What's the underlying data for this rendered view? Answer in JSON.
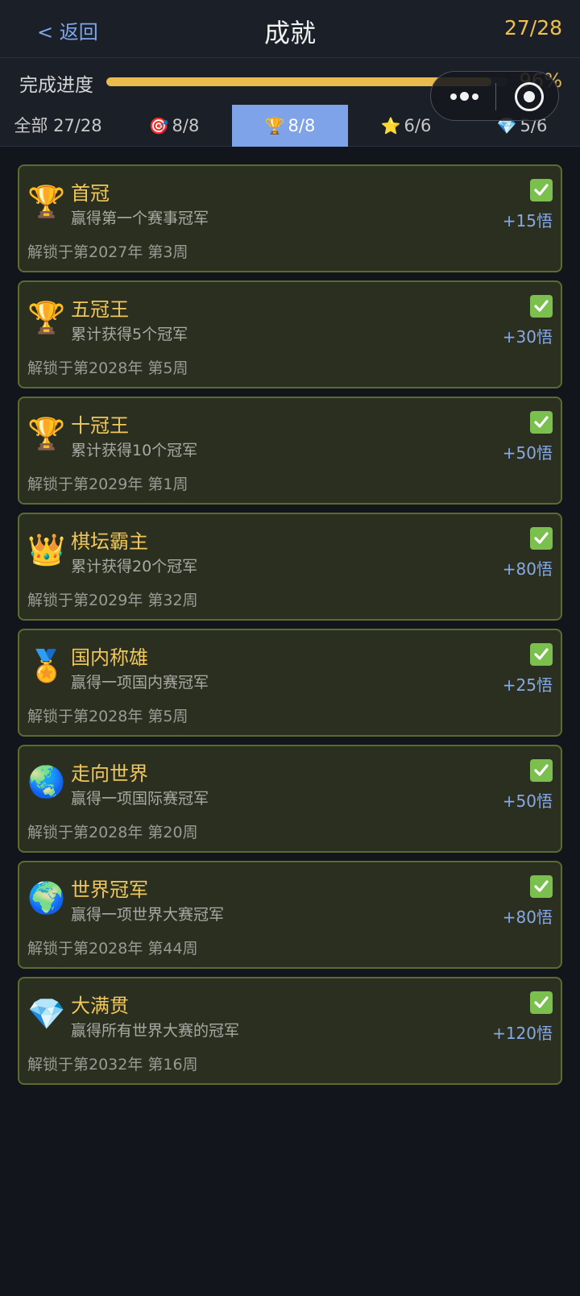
{
  "header": {
    "back_label": "< 返回",
    "title": "成就",
    "count": "27/28"
  },
  "progress": {
    "label": "完成进度",
    "percent_text": "96%",
    "fraction": 0.96
  },
  "tabs": [
    {
      "icon": "",
      "icon_name": "",
      "label": "全部 27/28",
      "active": false
    },
    {
      "icon": "🎯",
      "icon_name": "target-icon",
      "label": "8/8",
      "active": false
    },
    {
      "icon": "🏆",
      "icon_name": "trophy-icon",
      "label": "8/8",
      "active": true
    },
    {
      "icon": "⭐",
      "icon_name": "star-icon",
      "label": "6/6",
      "active": false
    },
    {
      "icon": "💎",
      "icon_name": "diamond-icon",
      "label": "5/6",
      "active": false
    }
  ],
  "achievements": [
    {
      "icon": "🏆",
      "icon_name": "trophy-icon",
      "title": "首冠",
      "desc": "赢得第一个赛事冠军",
      "date": "解锁于第2027年 第3周",
      "reward": "+15悟"
    },
    {
      "icon": "🏆",
      "icon_name": "trophy-icon",
      "title": "五冠王",
      "desc": "累计获得5个冠军",
      "date": "解锁于第2028年 第5周",
      "reward": "+30悟"
    },
    {
      "icon": "🏆",
      "icon_name": "trophy-icon",
      "title": "十冠王",
      "desc": "累计获得10个冠军",
      "date": "解锁于第2029年 第1周",
      "reward": "+50悟"
    },
    {
      "icon": "👑",
      "icon_name": "crown-icon",
      "title": "棋坛霸主",
      "desc": "累计获得20个冠军",
      "date": "解锁于第2029年 第32周",
      "reward": "+80悟"
    },
    {
      "icon": "🏅",
      "icon_name": "medal-icon",
      "title": "国内称雄",
      "desc": "赢得一项国内赛冠军",
      "date": "解锁于第2028年 第5周",
      "reward": "+25悟"
    },
    {
      "icon": "🌏",
      "icon_name": "globe-asia-icon",
      "title": "走向世界",
      "desc": "赢得一项国际赛冠军",
      "date": "解锁于第2028年 第20周",
      "reward": "+50悟"
    },
    {
      "icon": "🌍",
      "icon_name": "globe-africa-icon",
      "title": "世界冠军",
      "desc": "赢得一项世界大赛冠军",
      "date": "解锁于第2028年 第44周",
      "reward": "+80悟"
    },
    {
      "icon": "💎",
      "icon_name": "diamond-icon",
      "title": "大满贯",
      "desc": "赢得所有世界大赛的冠军",
      "date": "解锁于第2032年 第16周",
      "reward": "+120悟"
    }
  ],
  "colors": {
    "accent_gold": "#e8bb4c",
    "active_tab": "#7fa3e8",
    "card_bg": "#2b2f1f",
    "card_border": "#5d6b2c",
    "check_green": "#7bbf4e"
  }
}
